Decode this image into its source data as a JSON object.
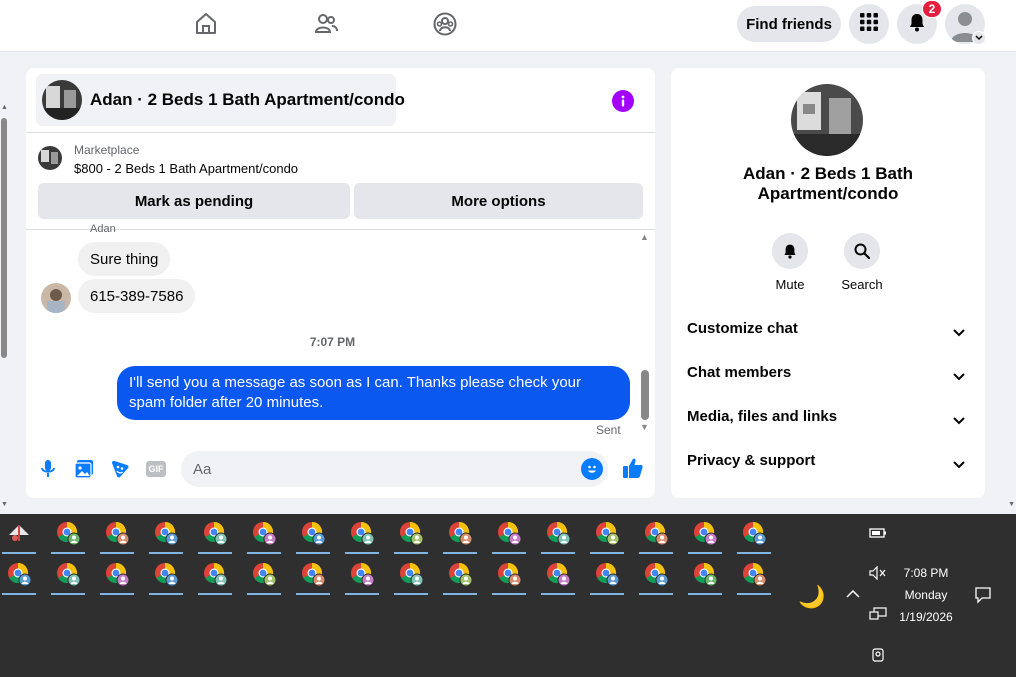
{
  "topnav": {
    "find_friends_label": "Find friends",
    "notification_count": "2"
  },
  "chat": {
    "title": "Adan · 2 Beds 1 Bath Apartment/condo",
    "marketplace_label": "Marketplace",
    "listing": "$800 - 2 Beds 1 Bath Apartment/condo",
    "mark_pending_label": "Mark as pending",
    "more_options_label": "More options",
    "sender_name": "Adan",
    "incoming": [
      "Sure thing",
      "615-389-7586"
    ],
    "timestamp": "7:07 PM",
    "outgoing": "I'll send you a message as soon as I can. Thanks please check your spam folder after 20 minutes.",
    "sent_status": "Sent",
    "composer_placeholder": "Aa",
    "gif_label": "GIF"
  },
  "side": {
    "title": "Adan · 2 Beds 1 Bath Apartment/condo",
    "mute_label": "Mute",
    "search_label": "Search",
    "sections": [
      "Customize chat",
      "Chat members",
      "Media, files and links",
      "Privacy & support"
    ]
  },
  "taskbar": {
    "time": "7:08 PM",
    "day": "Monday",
    "date": "1/19/2026"
  },
  "colors": {
    "accent": "#0a7cff",
    "outgoing_bubble": "#0a58f0",
    "info_icon": "#a200ff",
    "badge": "#e41e3f"
  }
}
